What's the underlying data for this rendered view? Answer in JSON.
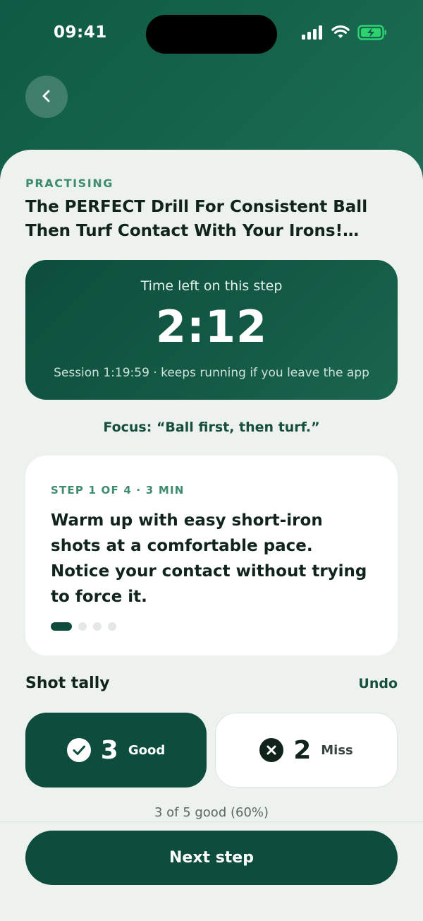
{
  "status_bar": {
    "time": "09:41",
    "icons": [
      "signal-icon",
      "wifi-icon",
      "battery-charging-icon"
    ],
    "battery_color": "#2dd36f"
  },
  "header": {
    "back_icon": "chevron-left-icon"
  },
  "drill": {
    "eyebrow": "PRACTISING",
    "title": "The PERFECT Drill For Consistent Ball Then Turf Contact With Your Irons! (Solid Strikes Guaranteed)"
  },
  "timer": {
    "label": "Time left on this step",
    "value": "2:12",
    "session_note": "Session 1:19:59 · keeps running if you leave the app"
  },
  "focus": "Focus: “Ball first, then turf.”",
  "step": {
    "meta": "STEP 1 OF 4 · 3 MIN",
    "text": "Warm up with easy short-iron shots at a comfortable pace. Notice your contact without trying to force it.",
    "current": 1,
    "total": 4
  },
  "tally": {
    "title": "Shot tally",
    "undo_label": "Undo",
    "good": {
      "count": "3",
      "label": "Good",
      "icon": "check-circle-icon"
    },
    "miss": {
      "count": "2",
      "label": "Miss",
      "icon": "x-circle-icon"
    },
    "summary": "3 of 5 good (60%)"
  },
  "footer": {
    "next_label": "Next step"
  },
  "colors": {
    "brand_dark": "#0e4d3d",
    "accent_green": "#3e8c6d",
    "background": "#edf2ef"
  }
}
